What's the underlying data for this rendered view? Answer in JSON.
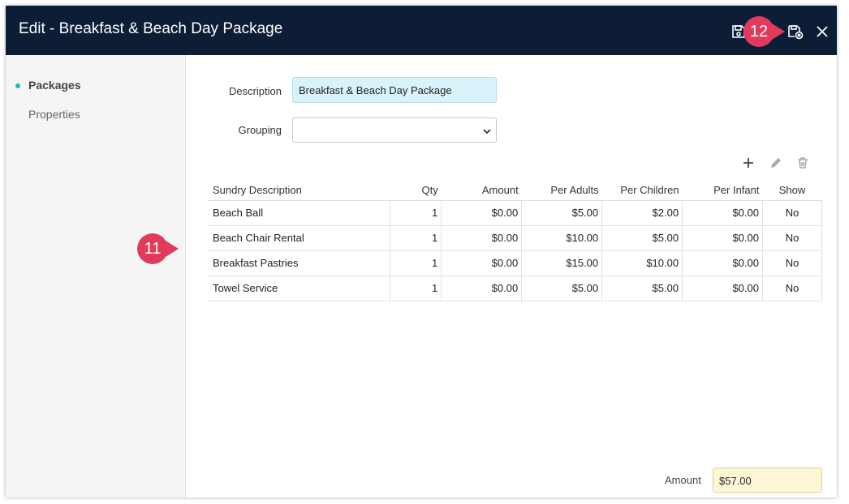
{
  "dialog": {
    "title": "Edit - Breakfast & Beach Day Package",
    "icons": [
      "save-icon",
      "save-close-icon",
      "close-icon"
    ]
  },
  "sidebar": {
    "items": [
      {
        "label": "Packages",
        "active": true
      },
      {
        "label": "Properties",
        "active": false
      }
    ]
  },
  "form": {
    "description_label": "Description",
    "description_value": "Breakfast & Beach Day Package",
    "grouping_label": "Grouping",
    "grouping_value": ""
  },
  "toolbar": {
    "icons": [
      "add-icon",
      "edit-icon",
      "delete-icon"
    ]
  },
  "table": {
    "columns": [
      "Sundry Description",
      "Qty",
      "Amount",
      "Per Adults",
      "Per Children",
      "Per Infant",
      "Show"
    ],
    "rows": [
      [
        "Beach Ball",
        "1",
        "$0.00",
        "$5.00",
        "$2.00",
        "$0.00",
        "No"
      ],
      [
        "Beach Chair Rental",
        "1",
        "$0.00",
        "$10.00",
        "$5.00",
        "$0.00",
        "No"
      ],
      [
        "Breakfast Pastries",
        "1",
        "$0.00",
        "$15.00",
        "$10.00",
        "$0.00",
        "No"
      ],
      [
        "Towel Service",
        "1",
        "$0.00",
        "$5.00",
        "$5.00",
        "$0.00",
        "No"
      ]
    ]
  },
  "footer": {
    "amount_label": "Amount",
    "amount_value": "$57.00"
  },
  "callouts": {
    "eleven": "11",
    "twelve": "12"
  },
  "colors": {
    "titlebar": "#0e1d36",
    "accent": "#1fb6c8",
    "callout": "#e03a5c",
    "description_bg": "#d8f3f9",
    "amount_bg": "#fdf8d4"
  }
}
